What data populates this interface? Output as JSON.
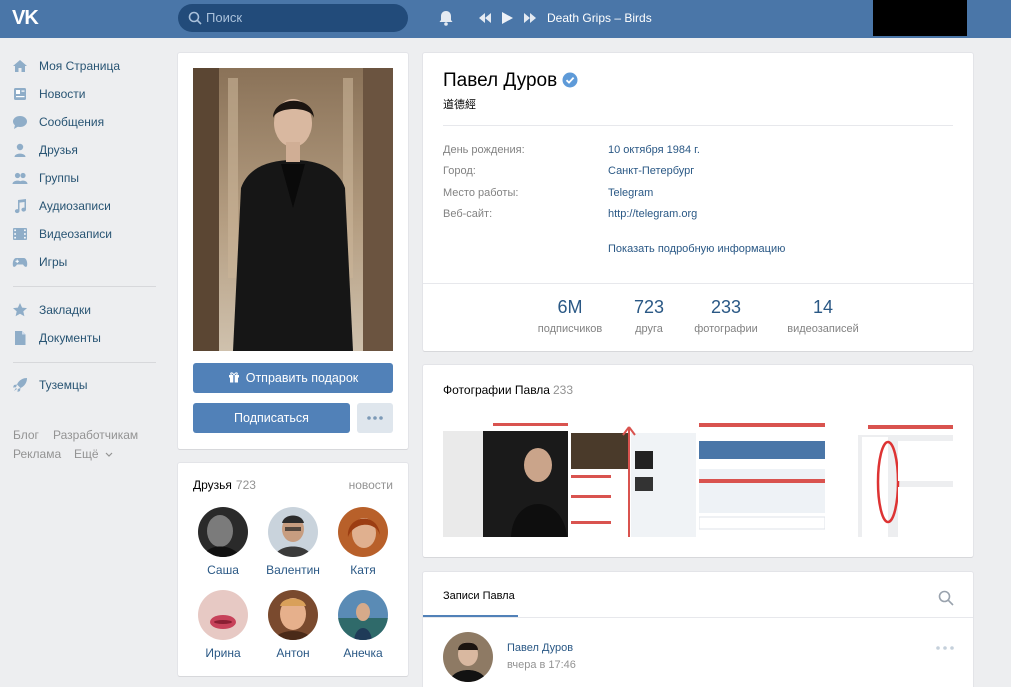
{
  "header": {
    "logo": "VK",
    "search_placeholder": "Поиск",
    "track": "Death Grips – Birds"
  },
  "nav": {
    "items": [
      {
        "label": "Моя Страница",
        "icon": "home-icon"
      },
      {
        "label": "Новости",
        "icon": "news-icon"
      },
      {
        "label": "Сообщения",
        "icon": "messages-icon"
      },
      {
        "label": "Друзья",
        "icon": "friends-icon"
      },
      {
        "label": "Группы",
        "icon": "groups-icon"
      },
      {
        "label": "Аудиозаписи",
        "icon": "music-icon"
      },
      {
        "label": "Видеозаписи",
        "icon": "video-icon"
      },
      {
        "label": "Игры",
        "icon": "games-icon"
      },
      {
        "label": "Закладки",
        "icon": "star-icon"
      },
      {
        "label": "Документы",
        "icon": "documents-icon"
      },
      {
        "label": "Туземцы",
        "icon": "rocket-icon"
      }
    ],
    "footer": {
      "blog": "Блог",
      "developers": "Разработчикам",
      "ads": "Реклама",
      "more": "Ещё"
    }
  },
  "profile": {
    "name": "Павел Дуров",
    "status": "道德經",
    "info": [
      {
        "label": "День рождения:",
        "value": "10 октября 1984 г."
      },
      {
        "label": "Город:",
        "value": "Санкт-Петербург"
      },
      {
        "label": "Место работы:",
        "value": "Telegram"
      },
      {
        "label": "Веб-сайт:",
        "value": "http://telegram.org"
      }
    ],
    "show_more": "Показать подробную информацию",
    "stats": [
      {
        "num": "6M",
        "label": "подписчиков"
      },
      {
        "num": "723",
        "label": "друга"
      },
      {
        "num": "233",
        "label": "фотографии"
      },
      {
        "num": "14",
        "label": "видеозаписей"
      }
    ]
  },
  "actions": {
    "gift": "Отправить подарок",
    "subscribe": "Подписаться"
  },
  "friends": {
    "title": "Друзья",
    "count": "723",
    "news": "новости",
    "list": [
      "Саша",
      "Валентин",
      "Катя",
      "Ирина",
      "Антон",
      "Анечка"
    ]
  },
  "photos": {
    "title": "Фотографии Павла",
    "count": "233"
  },
  "posts": {
    "tab": "Записи Павла",
    "author": "Павел Дуров",
    "time": "вчера в 17:46"
  },
  "colors": {
    "header": "#4a76a8",
    "link": "#2a5885",
    "button": "#5181b8"
  }
}
